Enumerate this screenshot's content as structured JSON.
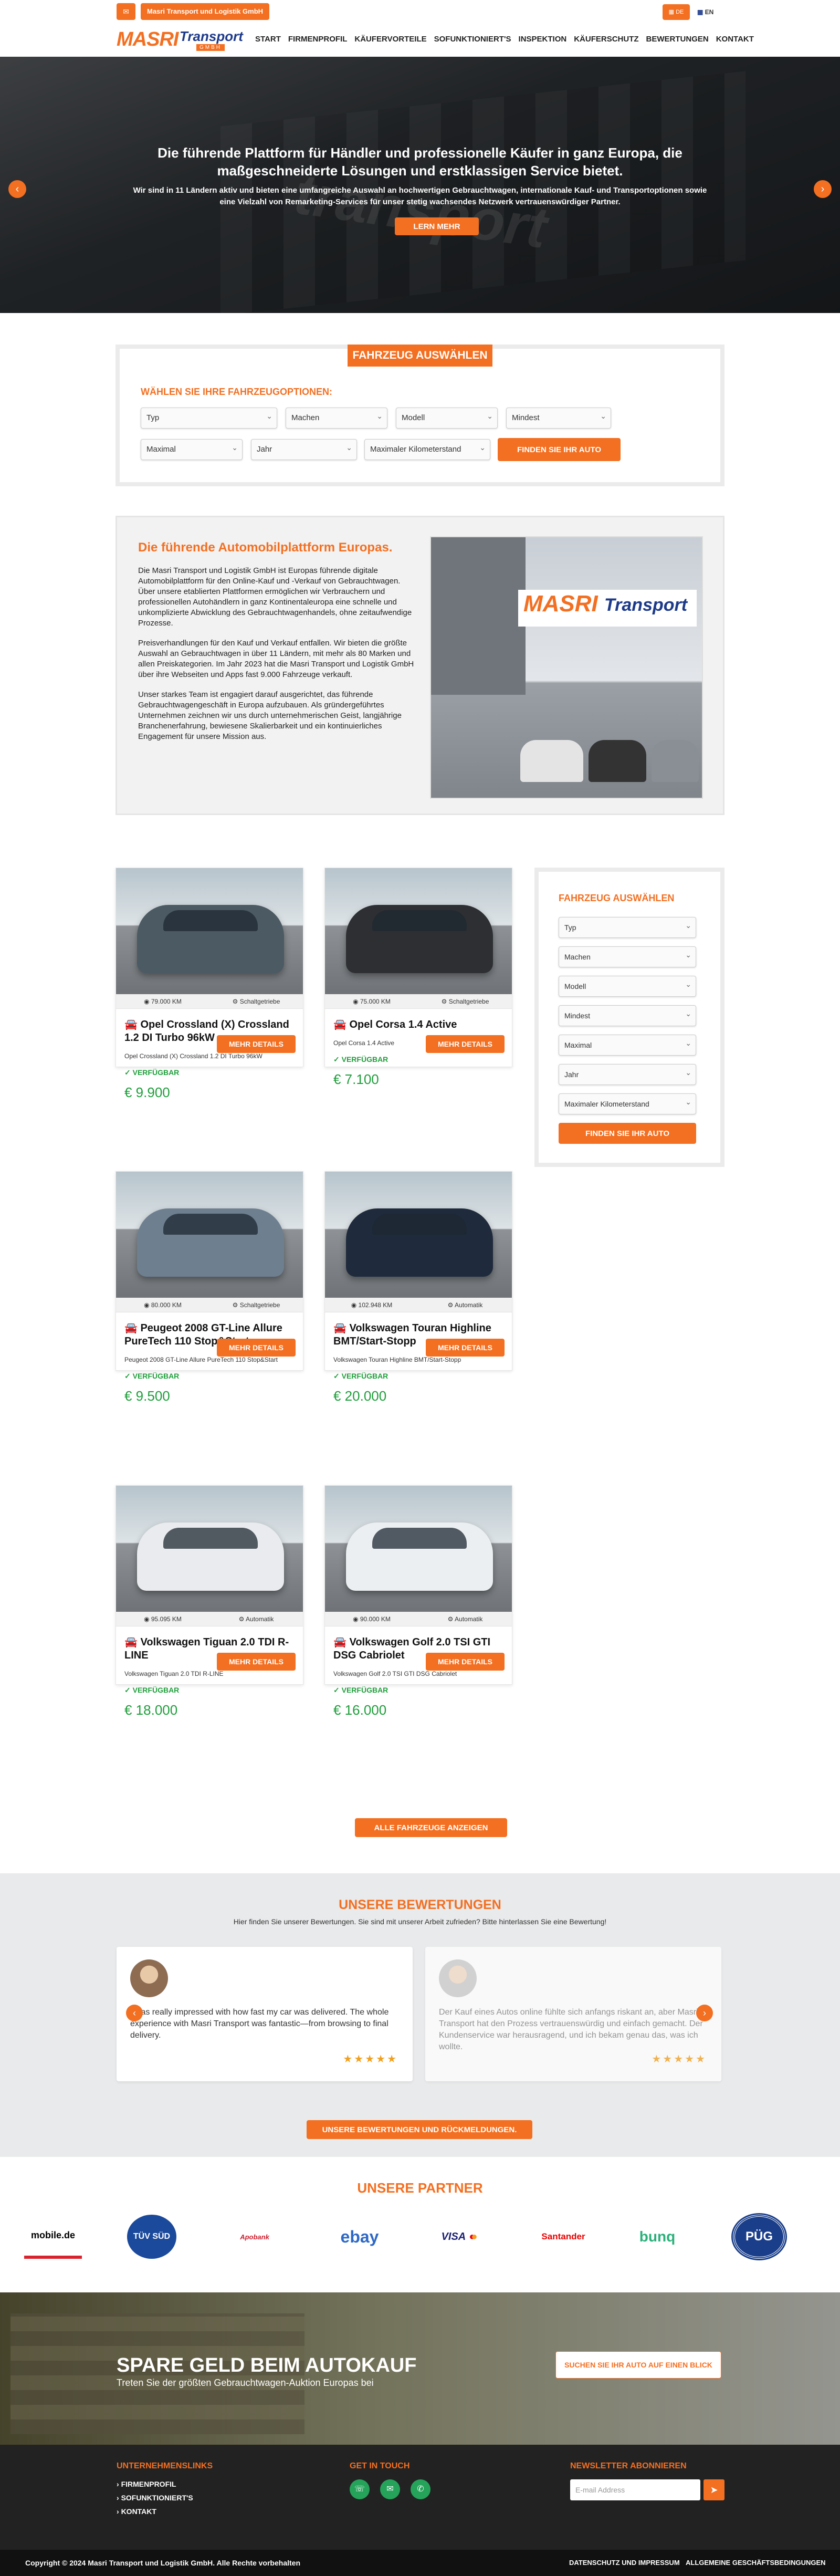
{
  "topbar": {
    "mail_icon": "envelope-icon",
    "company_label": "Masri Transport und Logistik GmbH",
    "lang_de": "DE",
    "lang_en": "EN"
  },
  "logo": {
    "masri": "MASRI",
    "transport": "Transport",
    "gmbh": "GMBH"
  },
  "nav": [
    "START",
    "FIRMENPROFIL",
    "KÄUFERVORTEILE",
    "SOFUNKTIONIERT'S",
    "INSPEKTION",
    "KÄUFERSCHUTZ",
    "BEWERTUNGEN",
    "KONTAKT"
  ],
  "hero": {
    "heading": "Die führende Plattform für Händler und professionelle Käufer in ganz Europa, die maßgeschneiderte Lösungen und erstklassigen Service bietet.",
    "text": "Wir sind in 11 Ländern aktiv und bieten eine umfangreiche Auswahl an hochwertigen Gebrauchtwagen, internationale Kauf- und Transportoptionen sowie eine Vielzahl von Remarketing-Services für unser stetig wachsendes Netzwerk vertrauenswürdiger Partner.",
    "button": "LERN MEHR",
    "watermark": "transport"
  },
  "search": {
    "title": "FAHRZEUG AUSWÄHLEN",
    "label": "WÄHLEN SIE IHRE FAHRZEUGOPTIONEN:",
    "fields": [
      "Typ",
      "Machen",
      "Modell",
      "Mindest",
      "Maximal",
      "Jahr",
      "Maximaler Kilometerstand"
    ],
    "button": "FINDEN SIE IHR AUTO"
  },
  "about": {
    "heading": "Die führende Automobilplattform Europas.",
    "paragraphs": [
      "Die Masri Transport und Logistik GmbH ist Europas führende digitale Automobilplattform für den Online-Kauf und -Verkauf von Gebrauchtwagen. Über unsere etablierten Plattformen ermöglichen wir Verbrauchern und professionellen Autohändlern in ganz Kontinentaleuropa eine schnelle und unkomplizierte Abwicklung des Gebrauchtwagenhandels, ohne zeitaufwendige Prozesse.",
      "Preisverhandlungen für den Kauf und Verkauf entfallen. Wir bieten die größte Auswahl an Gebrauchtwagen in über 11 Ländern, mit mehr als 80 Marken und allen Preiskategorien. Im Jahr 2023 hat die Masri Transport und Logistik GmbH über ihre Webseiten und Apps fast 9.000 Fahrzeuge verkauft.",
      "Unser starkes Team ist engagiert darauf ausgerichtet, das führende Gebrauchtwagengeschäft in Europa aufzubauen. Als gründergeführtes Unternehmen zeichnen wir uns durch unternehmerischen Geist, langjährige Branchenerfahrung, bewiesene Skalierbarkeit und ein kontinuierliches Engagement für unsere Mission aus."
    ],
    "sign_masri": "MASRI",
    "sign_transport": "Transport"
  },
  "cars": [
    {
      "km": "79.000 KM",
      "gear": "Schaltgetriebe",
      "title": "Opel Crossland (X) Crossland 1.2 DI Turbo 96kW",
      "sub": "Opel Crossland (X) Crossland 1.2 DI Turbo 96kW",
      "avail": "VERFÜGBAR",
      "price": "€ 9.900",
      "color": "#4c5a63"
    },
    {
      "km": "75.000 KM",
      "gear": "Schaltgetriebe",
      "title": "Opel Corsa 1.4 Active",
      "sub": "Opel Corsa 1.4 Active",
      "avail": "VERFÜGBAR",
      "price": "€ 7.100",
      "color": "#2d2f33"
    },
    {
      "km": "80.000 KM",
      "gear": "Schaltgetriebe",
      "title": "Peugeot 2008 GT-Line Allure PureTech 110 Stop&Start",
      "sub": "Peugeot 2008 GT-Line Allure PureTech 110 Stop&Start",
      "avail": "VERFÜGBAR",
      "price": "€ 9.500",
      "color": "#6e7f90"
    },
    {
      "km": "102.948 KM",
      "gear": "Automatik",
      "title": "Volkswagen Touran Highline BMT/Start-Stopp",
      "sub": "Volkswagen Touran Highline BMT/Start-Stopp",
      "avail": "VERFÜGBAR",
      "price": "€ 20.000",
      "color": "#1f2a3c"
    },
    {
      "km": "95.095 KM",
      "gear": "Automatik",
      "title": "Volkswagen Tiguan 2.0 TDI R-LINE",
      "sub": "Volkswagen Tiguan 2.0 TDI R-LINE",
      "avail": "VERFÜGBAR",
      "price": "€ 18.000",
      "color": "#e9ebee"
    },
    {
      "km": "90.000 KM",
      "gear": "Automatik",
      "title": "Volkswagen Golf 2.0 TSI GTI DSG Cabriolet",
      "sub": "Volkswagen Golf 2.0 TSI GTI DSG Cabriolet",
      "avail": "VERFÜGBAR",
      "price": "€ 16.000",
      "color": "#eceff1"
    }
  ],
  "car_button": "MEHR DETAILS",
  "all_button": "ALLE FAHRZEUGE ANZEIGEN",
  "sidebar": {
    "title": "FAHRZEUG AUSWÄHLEN",
    "fields": [
      "Typ",
      "Machen",
      "Modell",
      "Mindest",
      "Maximal",
      "Jahr",
      "Maximaler Kilometerstand"
    ],
    "button": "FINDEN SIE IHR AUTO"
  },
  "reviews": {
    "title": "UNSERE BEWERTUNGEN",
    "subtitle": "Hier finden Sie unserer Bewertungen. Sie sind mit unserer Arbeit zufrieden? Bitte hinterlassen Sie eine Bewertung!",
    "items": [
      {
        "text": "I was really impressed with how fast my car was delivered. The whole experience with Masri Transport was fantastic—from browsing to final delivery.",
        "stars": "★★★★★"
      },
      {
        "text": "Der Kauf eines Autos online fühlte sich anfangs riskant an, aber Masri Transport hat den Prozess vertrauenswürdig und einfach gemacht. Der Kundenservice war herausragend, und ich bekam genau das, was ich wollte.",
        "stars": "★★★★★"
      }
    ],
    "button": "UNSERE BEWERTUNGEN UND RÜCKMELDUNGEN."
  },
  "partners": {
    "title": "UNSERE PARTNER",
    "logos": [
      "mobile.de",
      "TÜV SÜD",
      "Apobank",
      "ebay",
      "VISA",
      "Santander",
      "bunq",
      "PÜG"
    ]
  },
  "cta": {
    "title": "SPARE GELD BEIM AUTOKAUF",
    "subtitle": "Treten Sie der größten Gebrauchtwagen-Auktion Europas bei",
    "button": "SUCHEN SIE IHR AUTO AUF EINEN BLICK"
  },
  "footer": {
    "col1_title": "UNTERNEHMENSLINKS",
    "links": [
      "FIRMENPROFIL",
      "SOFUNKTIONIERT'S",
      "KONTAKT"
    ],
    "col2_title": "GET IN TOUCH",
    "col3_title": "NEWSLETTER ABONNIEREN",
    "email_placeholder": "E-mail Address",
    "copyright": "Copyright © 2024 Masri Transport und Logistik GmbH. Alle Rechte vorbehalten",
    "link_privacy": "DATENSCHUTZ UND IMPRESSUM",
    "link_terms": "ALLGEMEINE GESCHÄFTSBEDINGUNGEN"
  },
  "colors": {
    "accent": "#f36f21",
    "available": "#1f9e3b",
    "brand_blue": "#1d3a8a"
  }
}
